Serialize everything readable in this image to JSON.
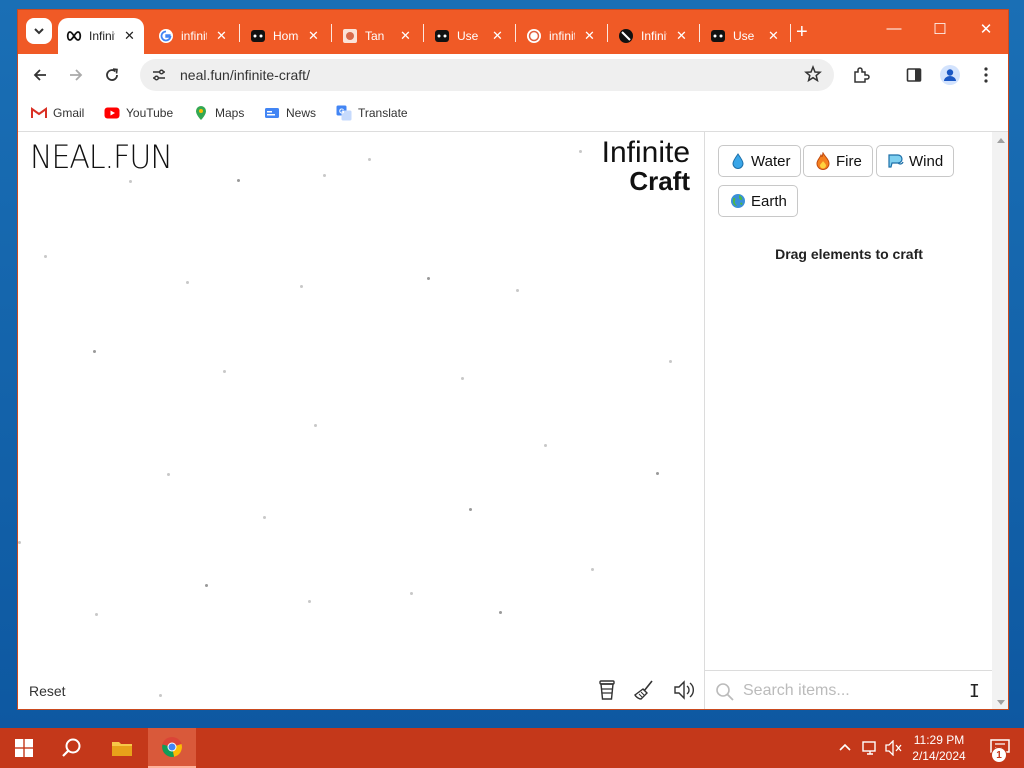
{
  "browser": {
    "tabs": [
      {
        "title": "Infinite Craft",
        "favicon": "infinity-icon",
        "active": true
      },
      {
        "title": "infinite craft - Google Search",
        "favicon": "google-icon"
      },
      {
        "title": "Home",
        "favicon": "game-icon"
      },
      {
        "title": "Tan",
        "favicon": "image-icon"
      },
      {
        "title": "Use",
        "favicon": "game-icon"
      },
      {
        "title": "infinite",
        "favicon": "site-icon"
      },
      {
        "title": "Infinite",
        "favicon": "circle-slash-icon"
      },
      {
        "title": "Use",
        "favicon": "game-icon"
      }
    ],
    "address_bar": {
      "url": "neal.fun/infinite-craft/"
    },
    "bookmarks": [
      {
        "label": "Gmail",
        "icon": "gmail-icon"
      },
      {
        "label": "YouTube",
        "icon": "youtube-icon"
      },
      {
        "label": "Maps",
        "icon": "maps-icon"
      },
      {
        "label": "News",
        "icon": "news-icon"
      },
      {
        "label": "Translate",
        "icon": "translate-icon"
      }
    ],
    "accent_color": "#f05a26"
  },
  "page": {
    "site_logo": "NEAL.FUN",
    "game_title_line1": "Infinite",
    "game_title_line2": "Craft",
    "reset_label": "Reset",
    "hint": "Drag elements to craft",
    "search_placeholder": "Search items...",
    "items": [
      {
        "label": "Water",
        "icon": "water-drop-icon"
      },
      {
        "label": "Fire",
        "icon": "fire-icon"
      },
      {
        "label": "Wind",
        "icon": "wind-icon"
      },
      {
        "label": "Earth",
        "icon": "earth-globe-icon"
      }
    ]
  },
  "taskbar": {
    "time": "11:29 PM",
    "date": "2/14/2024",
    "notification_count": "1",
    "color": "#c4381a"
  }
}
